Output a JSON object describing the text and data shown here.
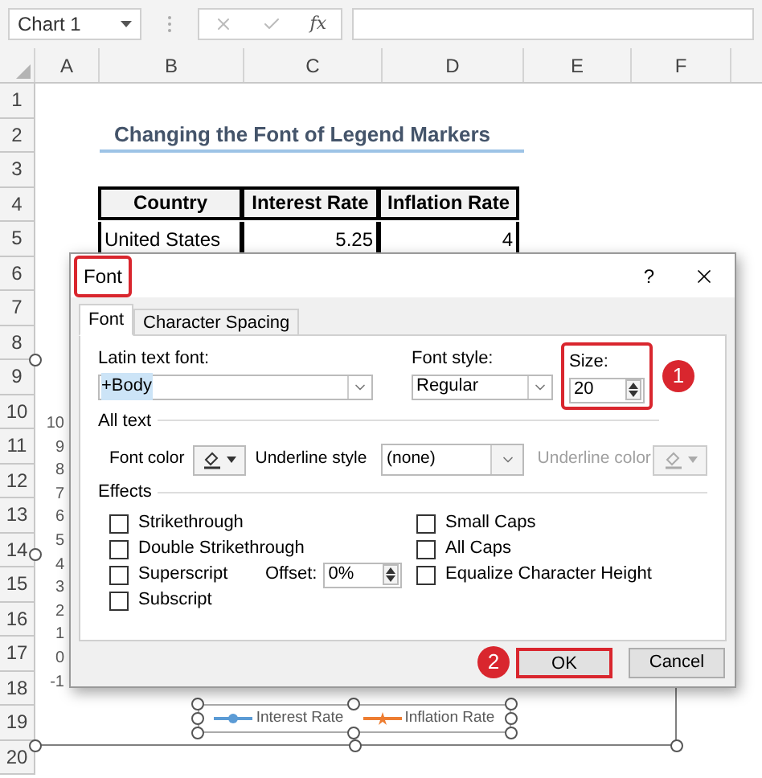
{
  "name_box": {
    "value": "Chart 1"
  },
  "formula_bar": {
    "function_label": "fx"
  },
  "columns": [
    "A",
    "B",
    "C",
    "D",
    "E",
    "F"
  ],
  "rows": [
    "1",
    "2",
    "3",
    "4",
    "5",
    "6",
    "7",
    "8",
    "9",
    "10",
    "11",
    "12",
    "13",
    "14",
    "15",
    "16",
    "17",
    "18",
    "19",
    "20"
  ],
  "sheet_title": "Changing the Font of Legend Markers",
  "table": {
    "columns": [
      "Country",
      "Interest Rate",
      "Inflation Rate"
    ],
    "rows": [
      [
        "United States",
        "5.25",
        "4"
      ]
    ]
  },
  "chart": {
    "axis_labels": [
      "10",
      "9",
      "8",
      "7",
      "6",
      "5",
      "4",
      "3",
      "2",
      "1",
      "0",
      "-1"
    ],
    "legend": [
      {
        "label": "Interest Rate",
        "color": "#5b9bd5",
        "kind": "circle"
      },
      {
        "label": "Inflation Rate",
        "color": "#ed7d31",
        "kind": "star"
      }
    ]
  },
  "dialog": {
    "title": "Font",
    "help": "?",
    "tabs": [
      {
        "label": "Font",
        "selected": true
      },
      {
        "label": "Character Spacing",
        "selected": false
      }
    ],
    "latin_font": {
      "label": "Latin text font:",
      "value": "+Body"
    },
    "font_style": {
      "label": "Font style:",
      "value": "Regular"
    },
    "size": {
      "label": "Size:",
      "value": "20"
    },
    "all_text": "All text",
    "font_color": {
      "label": "Font color"
    },
    "underline_style": {
      "label": "Underline style",
      "value": "(none)"
    },
    "underline_color": {
      "label": "Underline color",
      "disabled": true
    },
    "effects": "Effects",
    "effects_left": [
      {
        "label": "Strikethrough",
        "checked": false
      },
      {
        "label": "Double Strikethrough",
        "checked": false
      },
      {
        "label": "Superscript",
        "checked": false
      },
      {
        "label": "Subscript",
        "checked": false
      }
    ],
    "offset": {
      "label": "Offset:",
      "value": "0%"
    },
    "effects_right": [
      {
        "label": "Small Caps",
        "checked": false
      },
      {
        "label": "All Caps",
        "checked": false
      },
      {
        "label": "Equalize Character Height",
        "checked": false
      }
    ],
    "buttons": [
      {
        "label": "OK",
        "highlighted": true
      },
      {
        "label": "Cancel",
        "highlighted": false
      }
    ]
  },
  "steps": [
    "1",
    "2"
  ]
}
